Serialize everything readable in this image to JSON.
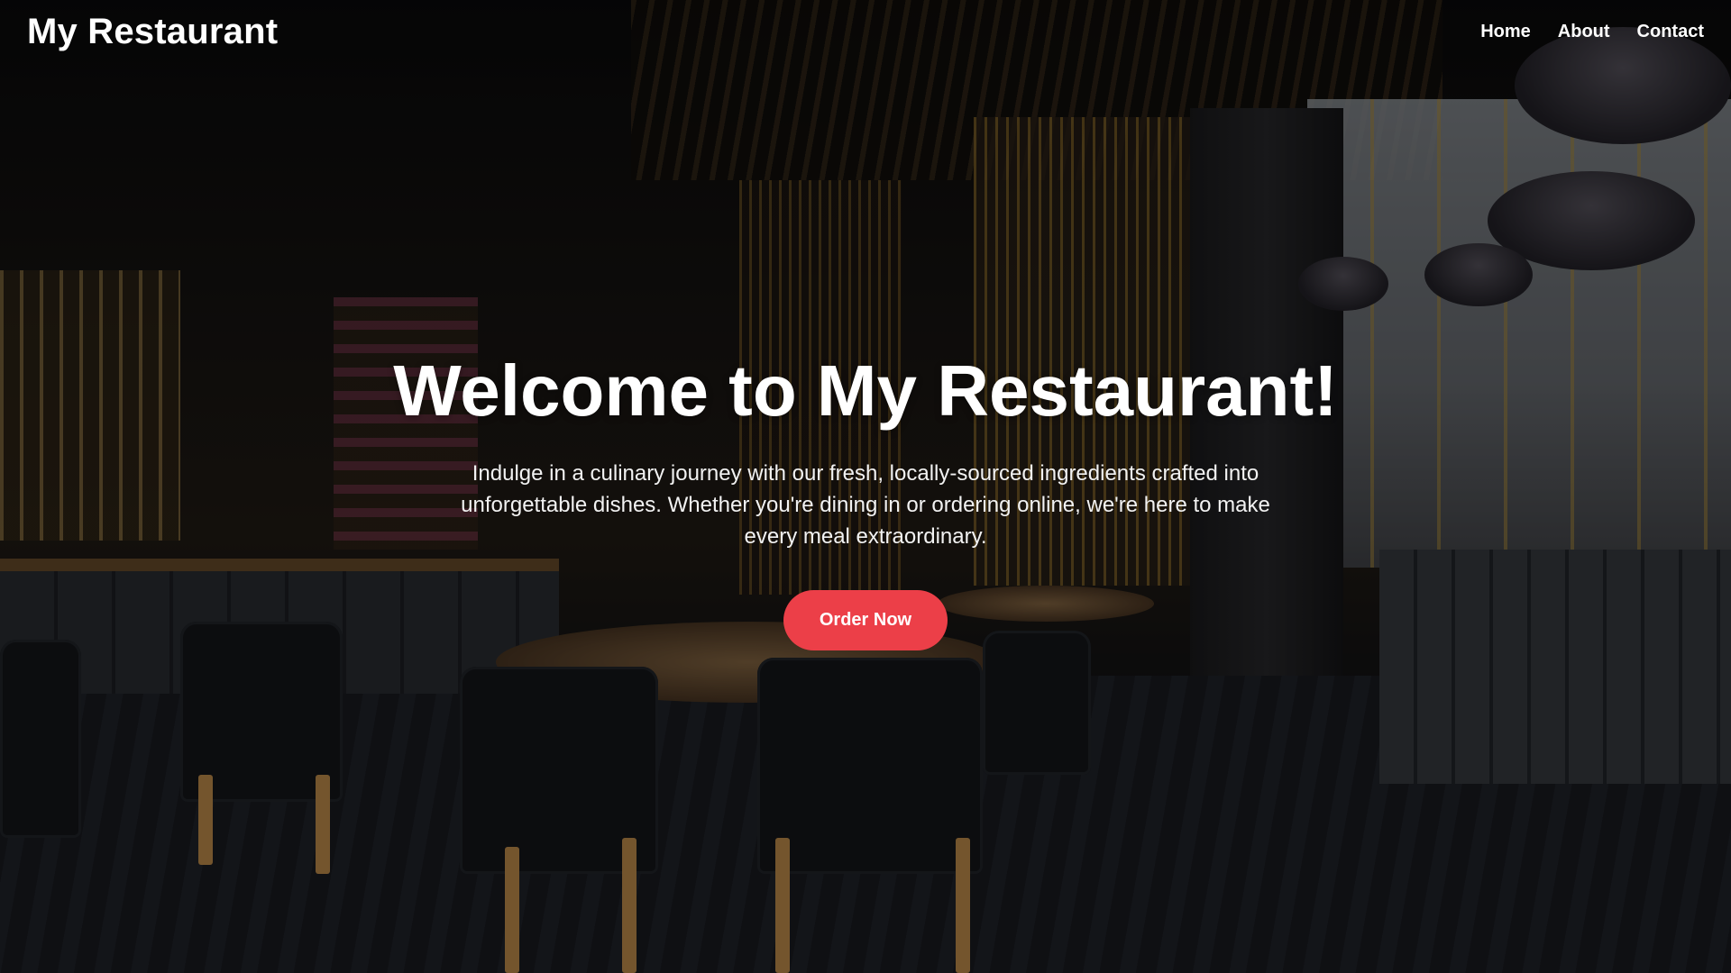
{
  "navbar": {
    "brand": "My Restaurant",
    "links": [
      "Home",
      "About",
      "Contact"
    ]
  },
  "hero": {
    "title": "Welcome to My Restaurant!",
    "text": "Indulge in a culinary journey with our fresh, locally-sourced ingredients crafted into unforgettable dishes. Whether you're dining in or ordering online, we're here to make every meal extraordinary.",
    "cta_label": "Order Now"
  },
  "colors": {
    "accent": "#ec3f48",
    "text": "#ffffff"
  }
}
